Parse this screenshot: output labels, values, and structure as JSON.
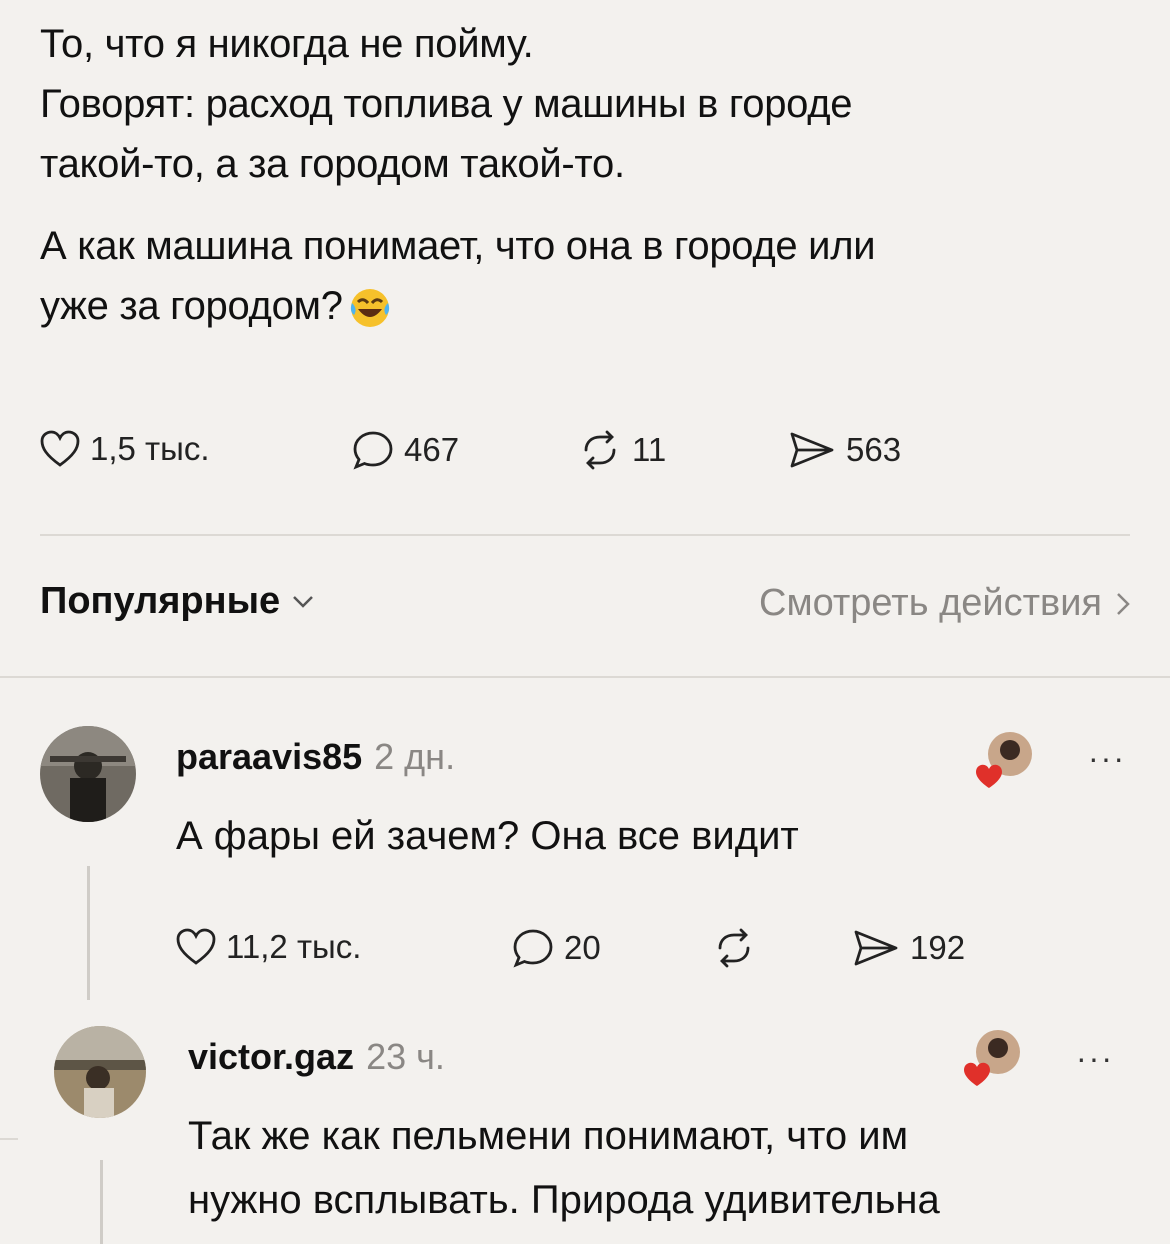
{
  "post": {
    "line1": "То, что я никогда не пойму.",
    "line2": "Говорят: расход топлива у машины в городе",
    "line3": "такой-то, а за городом такой-то.",
    "line4": "А как машина понимает, что она в городе или",
    "line5": "уже за городом?",
    "emoji": "laughing-with-tears"
  },
  "post_actions": {
    "likes": "1,5 тыс.",
    "comments": "467",
    "reposts": "11",
    "shares": "563"
  },
  "sort_bar": {
    "sort_label": "Популярные",
    "view_actions": "Смотреть действия"
  },
  "comments": [
    {
      "username": "paraavis85",
      "time": "2 дн.",
      "text": "А фары ей зачем? Она все видит",
      "likes": "11,2 тыс.",
      "replies": "20",
      "reposts": "",
      "shares": "192"
    },
    {
      "username": "victor.gaz",
      "time": "23 ч.",
      "text_line1": "Так же как пельмени понимают, что им",
      "text_line2": "нужно всплывать. Природа удивительна"
    }
  ],
  "colors": {
    "background": "#f3f1ee",
    "text": "#111111",
    "muted": "#8a8784",
    "heart_red": "#e0302a"
  }
}
